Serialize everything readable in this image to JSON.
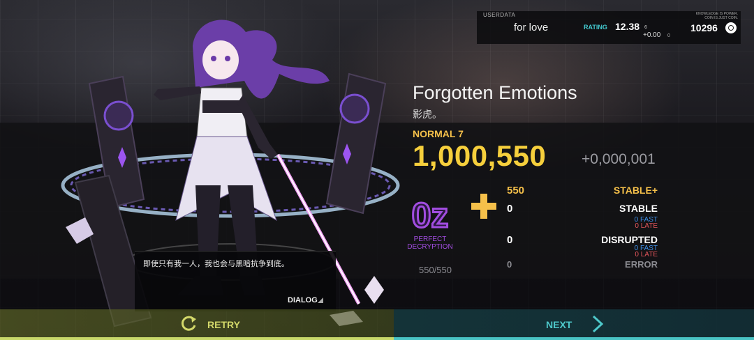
{
  "userdata": {
    "label": "USERDATA",
    "name": "for love",
    "rating_label": "RATING",
    "rating": "12.38",
    "rating_small": "6",
    "rating_delta": "+0.00",
    "rating_delta_small": "0",
    "motto_line1": "KNOWLEDGE IS POWER.",
    "motto_line2": "COIN IS JUST COIN.",
    "coins": "10296",
    "coin_icon": "coin-icon"
  },
  "song": {
    "title": "Forgotten Emotions",
    "artist": "影虎。",
    "difficulty": "NORMAL 7"
  },
  "result": {
    "score": "1,000,550",
    "score_delta": "+0,000,001",
    "grade": "0z",
    "grade_line1": "PERFECT",
    "grade_line2": "DECRYPTION",
    "combo": "550/550"
  },
  "judgements": {
    "stable_plus_count": "550",
    "stable_plus_label": "STABLE+",
    "stable_count": "0",
    "stable_label": "STABLE",
    "stable_fast": "0 FAST",
    "stable_late": "0 LATE",
    "disrupted_count": "0",
    "disrupted_label": "DISRUPTED",
    "disrupted_fast": "0 FAST",
    "disrupted_late": "0 LATE",
    "error_count": "0",
    "error_label": "ERROR"
  },
  "dialog": {
    "text": "即使只有我一人，我也会与黑暗抗争到底。",
    "button": "DIALOG"
  },
  "footer": {
    "retry_label": "RETRY",
    "next_label": "NEXT"
  },
  "colors": {
    "score_gold": "#f6cf3c",
    "rating_cyan": "#43c9cf",
    "fast_blue": "#3d8fe8",
    "late_red": "#e2555b",
    "grade_purple": "#a24de0",
    "retry_yellow": "#d3d86a",
    "next_cyan": "#4ec8ca"
  }
}
